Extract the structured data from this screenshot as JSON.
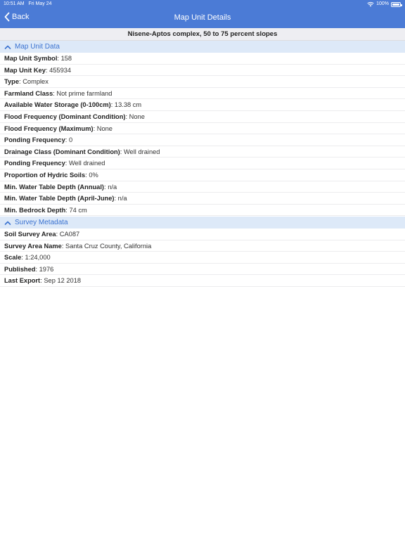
{
  "status_bar": {
    "time": "10:51 AM",
    "date": "Fri May 24",
    "battery": "100%"
  },
  "nav": {
    "back_label": "Back",
    "title": "Map Unit Details"
  },
  "subtitle": "Nisene-Aptos complex, 50 to 75 percent slopes",
  "sections": [
    {
      "title": "Map Unit Data",
      "rows": [
        {
          "label": "Map Unit Symbol",
          "value": "158"
        },
        {
          "label": "Map Unit Key",
          "value": "455934"
        },
        {
          "label": "Type",
          "value": "Complex"
        },
        {
          "label": "Farmland Class",
          "value": "Not prime farmland"
        },
        {
          "label": "Available Water Storage (0-100cm)",
          "value": "13.38 cm"
        },
        {
          "label": "Flood Frequency (Dominant Condition)",
          "value": "None"
        },
        {
          "label": "Flood Frequency (Maximum)",
          "value": "None"
        },
        {
          "label": "Ponding Frequency",
          "value": "0"
        },
        {
          "label": "Drainage Class (Dominant Condition)",
          "value": "Well drained"
        },
        {
          "label": "Ponding Frequency",
          "value": "Well drained"
        },
        {
          "label": "Proportion of Hydric Soils",
          "value": "0%"
        },
        {
          "label": "Min. Water Table Depth (Annual)",
          "value": "n/a"
        },
        {
          "label": "Min. Water Table Depth (April-June)",
          "value": "n/a"
        },
        {
          "label": "Min. Bedrock Depth",
          "value": "74 cm"
        }
      ]
    },
    {
      "title": "Survey Metadata",
      "rows": [
        {
          "label": "Soil Survey Area",
          "value": "CA087"
        },
        {
          "label": "Survey Area Name",
          "value": "Santa Cruz County, California"
        },
        {
          "label": "Scale",
          "value": "1:24,000"
        },
        {
          "label": "Published",
          "value": "1976"
        },
        {
          "label": "Last Export",
          "value": "Sep 12 2018"
        }
      ]
    }
  ],
  "colors": {
    "nav_bar": "#4b7bd6",
    "section_header_bg": "#dde9f8",
    "section_header_text": "#3a72d0"
  }
}
